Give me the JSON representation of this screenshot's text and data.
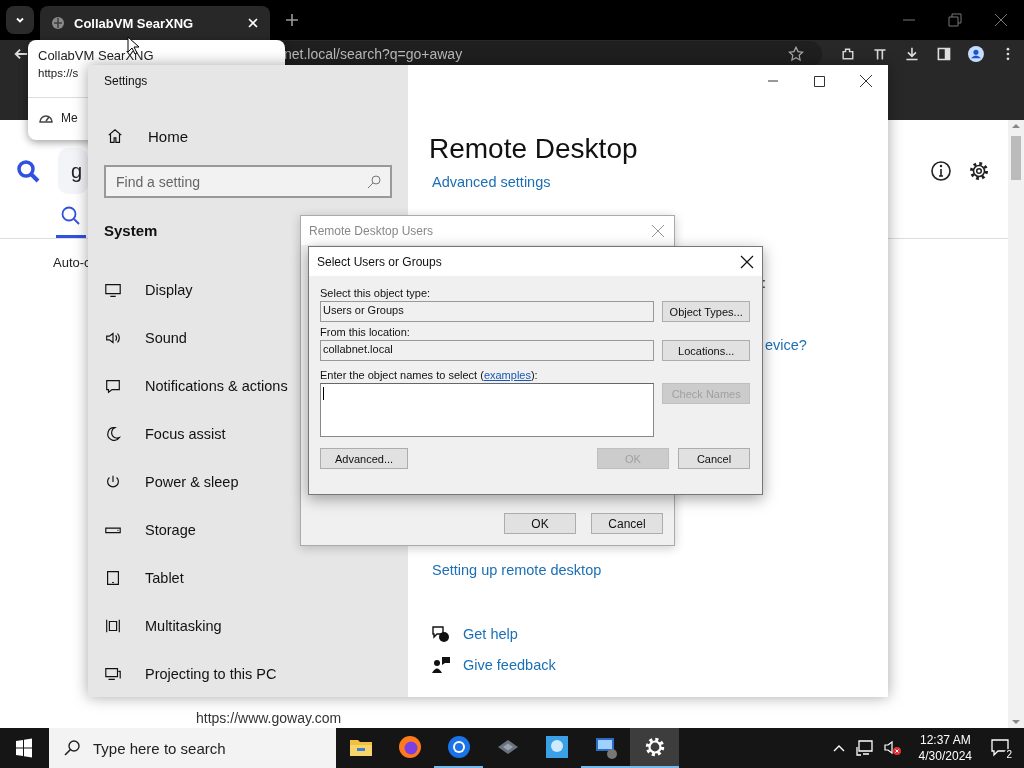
{
  "browser": {
    "tab": {
      "title": "CollabVM SearXNG",
      "selected": true
    },
    "address": "net.local/search?q=go+away",
    "hover_card": {
      "title": "CollabVM SearXNG",
      "url": "https://s",
      "menu_item": "Me"
    },
    "page": {
      "search_value": "g",
      "result_fragment": "Auto-c",
      "result_url": "https://www.goway.com"
    }
  },
  "settings": {
    "title": "Settings",
    "home": "Home",
    "search_placeholder": "Find a setting",
    "section": "System",
    "nav": [
      {
        "label": "Display"
      },
      {
        "label": "Sound"
      },
      {
        "label": "Notifications & actions"
      },
      {
        "label": "Focus assist"
      },
      {
        "label": "Power & sleep"
      },
      {
        "label": "Storage"
      },
      {
        "label": "Tablet"
      },
      {
        "label": "Multitasking"
      },
      {
        "label": "Projecting to this PC"
      }
    ],
    "heading": "Remote Desktop",
    "advanced_link": "Advanced settings",
    "fragments": [
      ":",
      "evice?"
    ],
    "setup_link": "Setting up remote desktop",
    "help_links": [
      {
        "label": "Get help"
      },
      {
        "label": "Give feedback"
      }
    ]
  },
  "remote_desktop_users": {
    "title": "Remote Desktop Users",
    "buttons": [
      {
        "label": "OK",
        "disabled": false
      },
      {
        "label": "Cancel",
        "disabled": false
      }
    ]
  },
  "select_dialog": {
    "title": "Select Users or Groups",
    "object_type_label": "Select this object type:",
    "object_type": "Users or Groups",
    "object_types_button": "Object Types...",
    "location_label": "From this location:",
    "location": "collabnet.local",
    "locations_button": "Locations...",
    "names_label": "Enter the object names to select (",
    "examples_link": "examples",
    "names_label_end": "):",
    "check_names": {
      "label": "Check Names",
      "disabled": true
    },
    "buttons": [
      {
        "label": "Advanced...",
        "disabled": false
      },
      {
        "label": "OK",
        "disabled": true
      },
      {
        "label": "Cancel",
        "disabled": false
      }
    ]
  },
  "taskbar": {
    "search_placeholder": "Type here to search",
    "apps": [
      {
        "running": false,
        "selected": false
      },
      {
        "running": false,
        "selected": false
      },
      {
        "running": true,
        "selected": false
      },
      {
        "running": false,
        "selected": false
      },
      {
        "running": false,
        "selected": false
      },
      {
        "running": true,
        "selected": false
      },
      {
        "running": true,
        "selected": true
      }
    ],
    "time": "12:37 AM",
    "date": "4/30/2024",
    "notification_count": "2"
  }
}
